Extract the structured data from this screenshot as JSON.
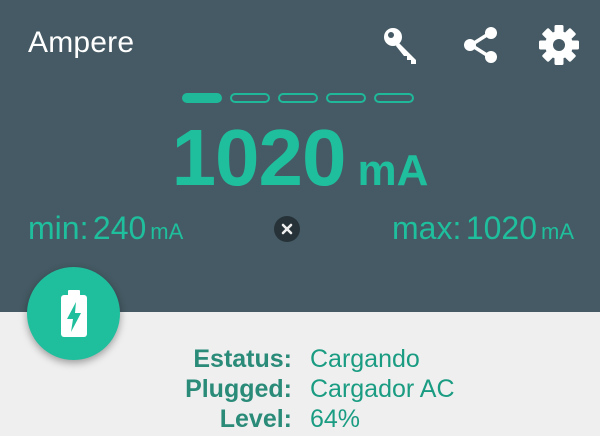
{
  "app": {
    "title": "Ampere"
  },
  "toolbar": {
    "icons": [
      "key-icon",
      "share-icon",
      "gear-icon"
    ]
  },
  "pager": {
    "count": 5,
    "active": 0
  },
  "reading": {
    "value": "1020",
    "unit": "mA"
  },
  "stats": {
    "min_label": "min:",
    "min_value": "240",
    "min_unit": "mA",
    "max_label": "max:",
    "max_value": "1020",
    "max_unit": "mA"
  },
  "info": {
    "rows": [
      {
        "key": "Estatus:",
        "value": "Cargando"
      },
      {
        "key": "Plugged:",
        "value": "Cargador AC"
      },
      {
        "key": "Level:",
        "value": "64%"
      }
    ]
  },
  "colors": {
    "header": "#455a64",
    "accent": "#1fbf9d",
    "background": "#efefef"
  }
}
